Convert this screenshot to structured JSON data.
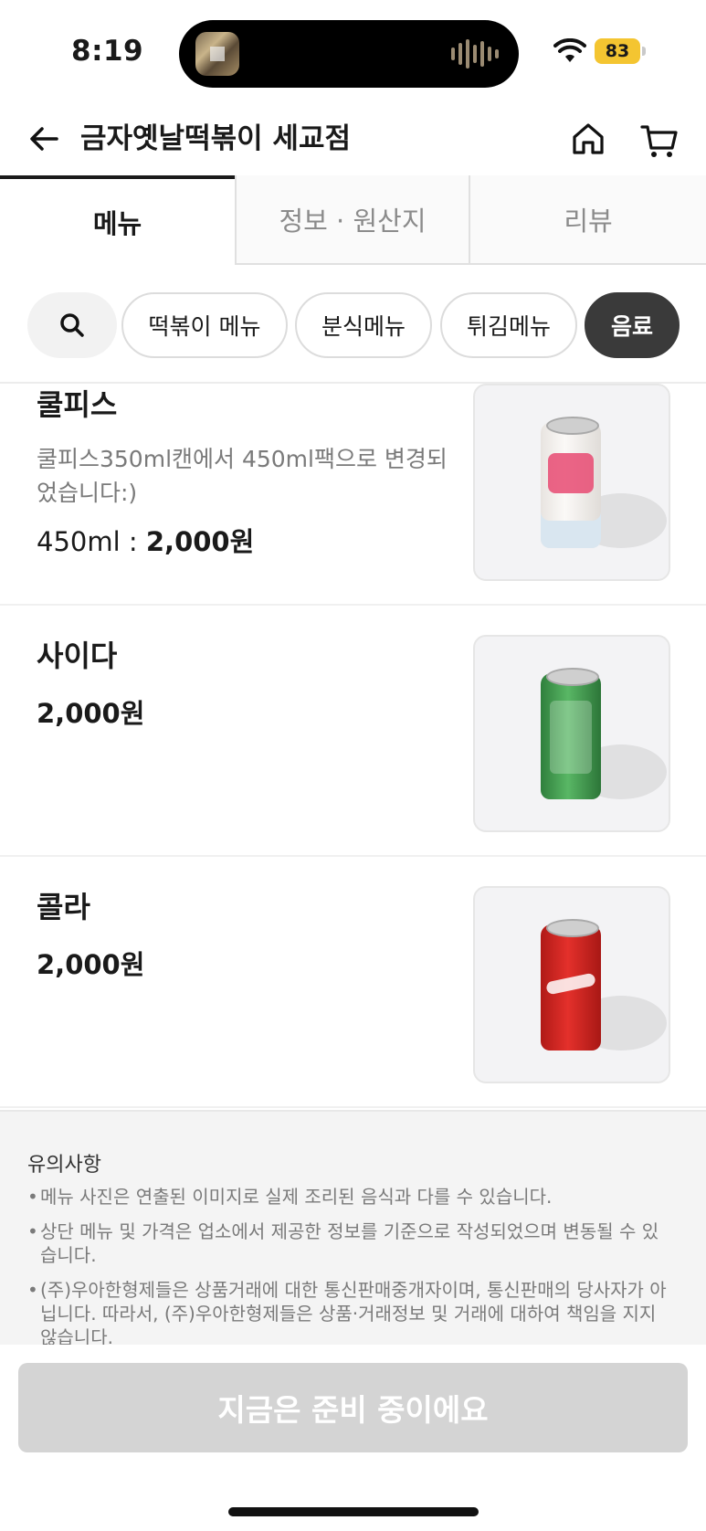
{
  "status_bar": {
    "time": "8:19",
    "battery": "83"
  },
  "header": {
    "title": "금자옛날떡볶이 세교점"
  },
  "tabs": [
    {
      "label": "메뉴",
      "active": true
    },
    {
      "label": "정보 · 원산지",
      "active": false
    },
    {
      "label": "리뷰",
      "active": false
    }
  ],
  "categories": [
    {
      "label": "떡볶이 메뉴",
      "active": false
    },
    {
      "label": "분식메뉴",
      "active": false
    },
    {
      "label": "튀김메뉴",
      "active": false
    },
    {
      "label": "음료",
      "active": true
    }
  ],
  "menu_items": [
    {
      "name": "쿨피스",
      "description": "쿨피스350ml캔에서 450ml팩으로 변경되었습니다:)",
      "price_prefix": "450ml : ",
      "price": "2,000원",
      "can_color": "#f4f1ee"
    },
    {
      "name": "사이다",
      "price": "2,000원",
      "can_color": "#3f9e4d"
    },
    {
      "name": "콜라",
      "price": "2,000원",
      "can_color": "#d8231f"
    }
  ],
  "notice": {
    "title": "유의사항",
    "items": [
      "메뉴 사진은 연출된 이미지로 실제 조리된 음식과 다를 수 있습니다.",
      "상단 메뉴 및 가격은 업소에서 제공한 정보를 기준으로 작성되었으며 변동될 수 있습니다.",
      "(주)우아한형제들은 상품거래에 대한 통신판매중개자이며, 통신판매의 당사자가 아닙니다. 따라서, (주)우아한형제들은 상품·거래정보 및 거래에 대하여 책임을 지지 않습니다."
    ]
  },
  "cta": {
    "label": "지금은 준비 중이에요"
  }
}
